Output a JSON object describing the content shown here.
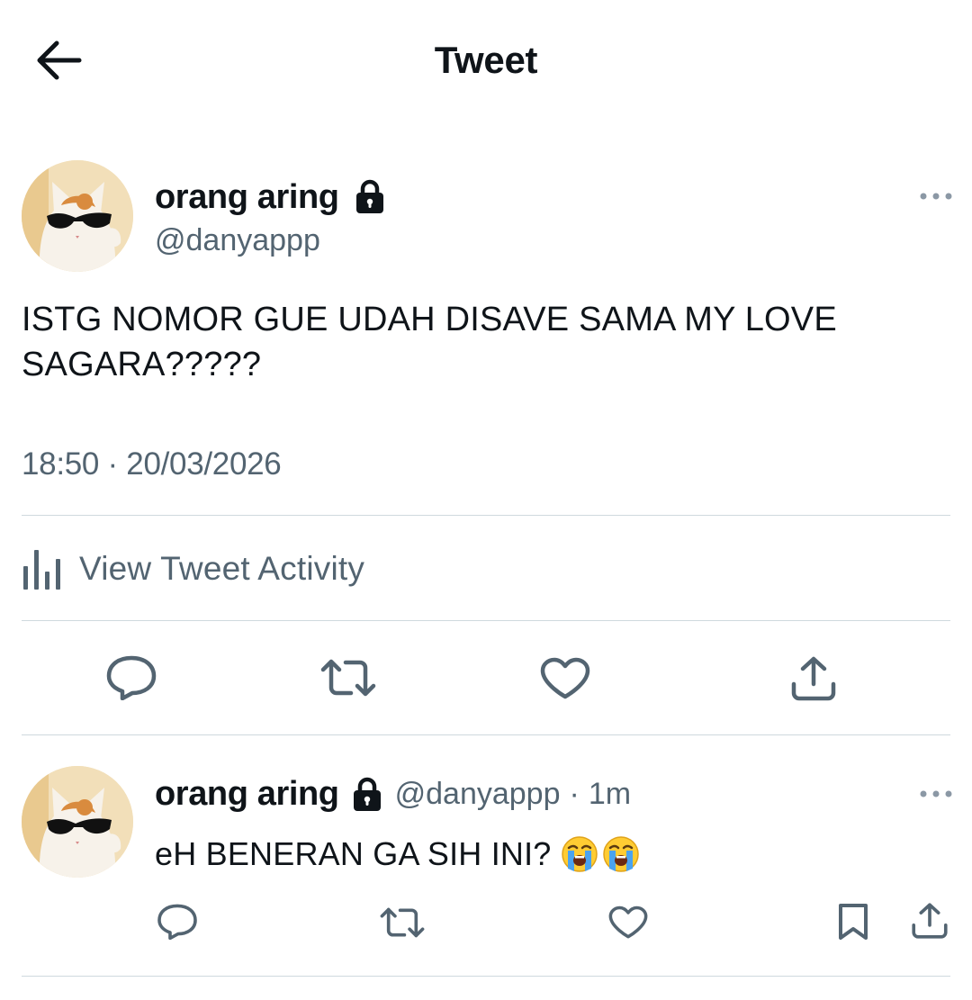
{
  "header": {
    "title": "Tweet",
    "back_icon": "arrow-left-icon"
  },
  "tweet": {
    "author_name": "orang aring",
    "author_handle": "@danyappp",
    "protected": true,
    "text": "ISTG NOMOR GUE UDAH DISAVE SAMA MY LOVE SAGARA?????",
    "timestamp": "18:50 · 20/03/2026",
    "activity_label": "View Tweet Activity",
    "actions": [
      "reply-icon",
      "retweet-icon",
      "like-icon",
      "share-icon"
    ]
  },
  "reply": {
    "author_name": "orang aring",
    "author_handle": "@danyappp",
    "separator": "·",
    "time": "1m",
    "text": "eH BENERAN GA SIH INI?",
    "emojis": [
      "loudly-crying-face",
      "loudly-crying-face"
    ],
    "actions": [
      "reply-icon",
      "retweet-icon",
      "like-icon",
      "bookmark-icon",
      "share-icon"
    ]
  },
  "colors": {
    "text": "#0f1419",
    "secondary": "#536471",
    "divider": "#cfd9de"
  }
}
